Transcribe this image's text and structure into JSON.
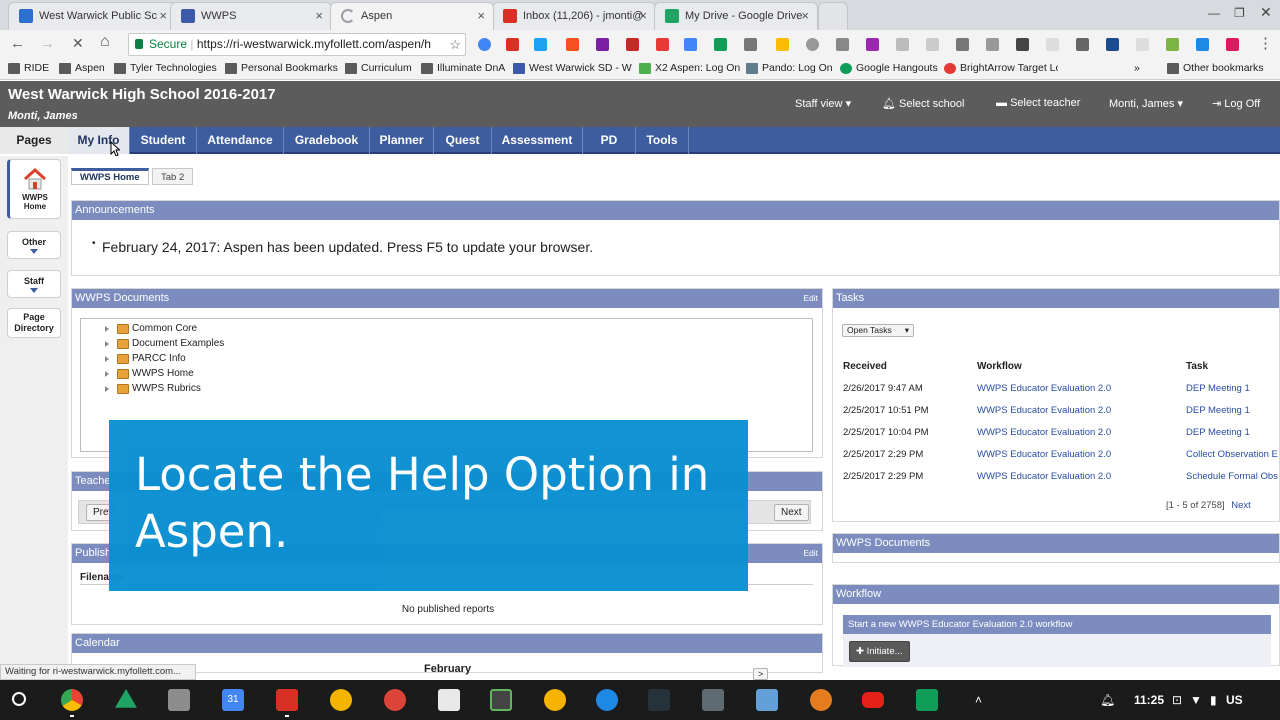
{
  "browser": {
    "tabs": [
      {
        "title": "West Warwick Public Sc",
        "favicon_color": "#2d6fcf",
        "active": false
      },
      {
        "title": "WWPS",
        "favicon_color": "#3d5aa8",
        "active": false
      },
      {
        "title": "Aspen",
        "favicon_color": "#9aa0a6",
        "active": true
      },
      {
        "title": "Inbox (11,206) - jmonti@",
        "favicon_color": "#d93025",
        "active": false
      },
      {
        "title": "My Drive - Google Drive",
        "favicon_color": "#1fa463",
        "active": false
      }
    ],
    "secure_label": "Secure",
    "url": "https://ri-westwarwick.myfollett.com/aspen/h",
    "bookmarks": [
      "RIDE",
      "Aspen",
      "Tyler Technologies",
      "Personal Bookmarks",
      "Curriculum",
      "Illuminate DnA",
      "West Warwick SD - W",
      "X2 Aspen: Log On",
      "Pando: Log On",
      "Google Hangouts",
      "BrightArrow Target Lo"
    ],
    "other_bookmarks": "Other bookmarks",
    "more_bookmarks": "»"
  },
  "aspen": {
    "school_title": "West Warwick High School 2016-2017",
    "user_name": "Monti, James",
    "header_links": {
      "staff_view": "Staff view",
      "select_school": "Select school",
      "select_teacher": "Select teacher",
      "user_menu": "Monti, James",
      "log_off": "Log Off"
    },
    "pages_label": "Pages",
    "nav_tabs": [
      "My Info",
      "Student",
      "Attendance",
      "Gradebook",
      "Planner",
      "Quest",
      "Assessment",
      "PD",
      "Tools"
    ],
    "active_nav_tab": "My Info",
    "sidebar": {
      "home_label": "WWPS Home",
      "other_label": "Other",
      "staff_label": "Staff",
      "page_directory_label": "Page Directory"
    },
    "sub_tabs": [
      "WWPS Home",
      "Tab 2"
    ],
    "announcements": {
      "title": "Announcements",
      "items": [
        "February 24, 2017: Aspen has been updated. Press F5 to update your browser."
      ]
    },
    "documents": {
      "title": "WWPS Documents",
      "edit_label": "Edit",
      "folders": [
        "Common Core",
        "Document Examples",
        "PARCC Info",
        "WWPS Home",
        "WWPS Rubrics"
      ]
    },
    "teacher_panel": {
      "title": "Teache",
      "prev_label": "Previ",
      "next_label": "Next"
    },
    "published_reports": {
      "title": "Publish",
      "edit_label": "Edit",
      "col_filename": "Filename",
      "empty_text": "No published reports"
    },
    "calendar": {
      "title": "Calendar",
      "month": "February",
      "next_label": ">"
    },
    "tasks": {
      "title": "Tasks",
      "filter_value": "Open Tasks",
      "columns": [
        "Received",
        "Workflow",
        "Task"
      ],
      "rows": [
        {
          "received": "2/26/2017 9:47 AM",
          "workflow": "WWPS Educator Evaluation 2.0",
          "task": "DEP Meeting 1"
        },
        {
          "received": "2/25/2017 10:51 PM",
          "workflow": "WWPS Educator Evaluation 2.0",
          "task": "DEP Meeting 1"
        },
        {
          "received": "2/25/2017 10:04 PM",
          "workflow": "WWPS Educator Evaluation 2.0",
          "task": "DEP Meeting 1"
        },
        {
          "received": "2/25/2017 2:29 PM",
          "workflow": "WWPS Educator Evaluation 2.0",
          "task": "Collect Observation E"
        },
        {
          "received": "2/25/2017 2:29 PM",
          "workflow": "WWPS Educator Evaluation 2.0",
          "task": "Schedule Formal Obs"
        }
      ],
      "pagination": "[1 - 5 of 2758]",
      "next_label": "Next"
    },
    "right_documents": {
      "title": "WWPS Documents"
    },
    "workflow": {
      "title": "Workflow",
      "start_text": "Start a new WWPS Educator Evaluation 2.0 workflow",
      "initiate_label": "Initiate..."
    }
  },
  "overlay": {
    "text": "Locate the Help Option in Aspen."
  },
  "status_bar": "Waiting for ri-westwarwick.myfollett.com...",
  "taskbar": {
    "time": "11:25",
    "locale": "US"
  }
}
